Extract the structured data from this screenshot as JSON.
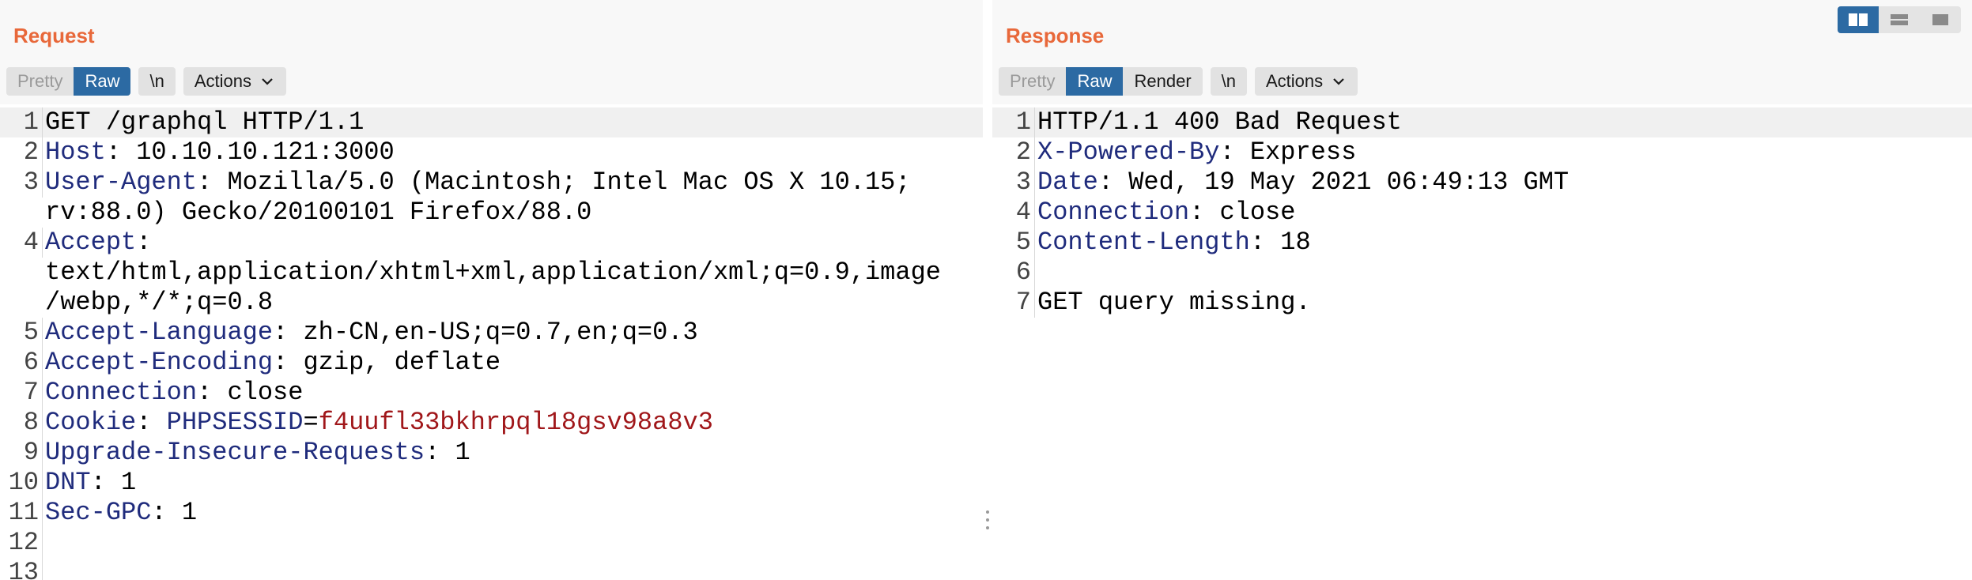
{
  "layout_toggle": {
    "options": [
      "side-by-side",
      "stacked-rows",
      "single-tab"
    ],
    "selected": "side-by-side"
  },
  "request": {
    "title": "Request",
    "view_modes": [
      "Pretty",
      "Raw"
    ],
    "active_view": "Raw",
    "newline_button": "\\n",
    "actions_button": "Actions",
    "lines": [
      {
        "num": "1",
        "text": "GET /graphql HTTP/1.1"
      },
      {
        "num": "2",
        "name": "Host",
        "value": ": 10.10.10.121:3000"
      },
      {
        "num": "3",
        "name": "User-Agent",
        "value": ": Mozilla/5.0 (Macintosh; Intel Mac OS X 10.15;",
        "cont": [
          "rv:88.0) Gecko/20100101 Firefox/88.0"
        ]
      },
      {
        "num": "4",
        "name": "Accept",
        "value": ":",
        "cont": [
          "text/html,application/xhtml+xml,application/xml;q=0.9,image",
          "/webp,*/*;q=0.8"
        ]
      },
      {
        "num": "5",
        "name": "Accept-Language",
        "value": ": zh-CN,en-US;q=0.7,en;q=0.3"
      },
      {
        "num": "6",
        "name": "Accept-Encoding",
        "value": ": gzip, deflate"
      },
      {
        "num": "7",
        "name": "Connection",
        "value": ": close"
      },
      {
        "num": "8",
        "name": "Cookie",
        "value": ": ",
        "cookie_name": "PHPSESSID",
        "cookie_eq": "=",
        "cookie_value": "f4uufl33bkhrpql18gsv98a8v3"
      },
      {
        "num": "9",
        "name": "Upgrade-Insecure-Requests",
        "value": ": 1"
      },
      {
        "num": "10",
        "name": "DNT",
        "value": ": 1"
      },
      {
        "num": "11",
        "name": "Sec-GPC",
        "value": ": 1"
      },
      {
        "num": "12",
        "text": ""
      },
      {
        "num": "13",
        "text": ""
      }
    ]
  },
  "response": {
    "title": "Response",
    "view_modes": [
      "Pretty",
      "Raw",
      "Render"
    ],
    "active_view": "Raw",
    "newline_button": "\\n",
    "actions_button": "Actions",
    "lines": [
      {
        "num": "1",
        "text": "HTTP/1.1 400 Bad Request"
      },
      {
        "num": "2",
        "name": "X-Powered-By",
        "value": ": Express"
      },
      {
        "num": "3",
        "name": "Date",
        "value": ": Wed, 19 May 2021 06:49:13 GMT"
      },
      {
        "num": "4",
        "name": "Connection",
        "value": ": close"
      },
      {
        "num": "5",
        "name": "Content-Length",
        "value": ": 18"
      },
      {
        "num": "6",
        "text": ""
      },
      {
        "num": "7",
        "text": "GET query missing."
      }
    ]
  },
  "colors": {
    "accent_title": "#e8683a",
    "active_button": "#2c6aa3",
    "header_name": "#1f2b7c",
    "cookie_value": "#a0171a"
  }
}
